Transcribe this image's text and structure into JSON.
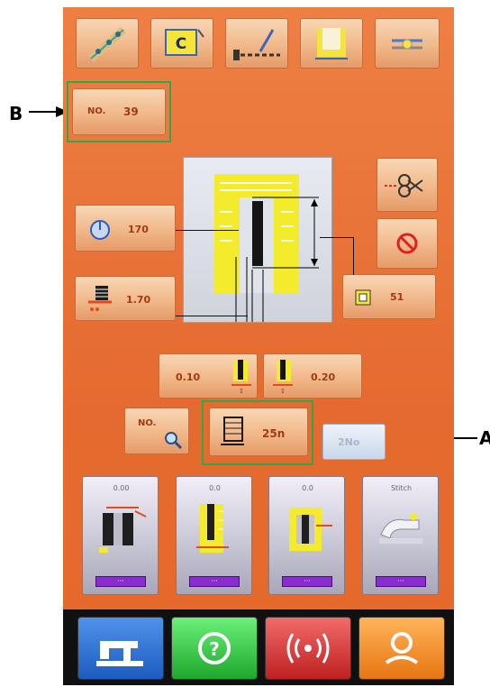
{
  "callouts": {
    "b_label": "B",
    "a_label": "A"
  },
  "toolbar": {
    "items": [
      {
        "name": "thread-path-icon"
      },
      {
        "name": "c-pattern-icon",
        "glyph": "C"
      },
      {
        "name": "stitch-line-icon"
      },
      {
        "name": "bartack-frame-icon"
      },
      {
        "name": "tension-icon"
      }
    ]
  },
  "pattern_no": {
    "label": "NO.",
    "value": "39"
  },
  "params": {
    "speed": "170",
    "width": "1.70",
    "length_left": "0.10",
    "length_right": "0.20",
    "counter": "51",
    "stitches": "25n"
  },
  "sub_buttons": {
    "no_search_label": "NO.",
    "disabled_label": "2No"
  },
  "cards": [
    {
      "top": "0.00",
      "tag": "···"
    },
    {
      "top": "0.0",
      "tag": "···"
    },
    {
      "top": "0.0",
      "tag": "···"
    },
    {
      "top": "Stitch",
      "tag": "···"
    }
  ],
  "colors": {
    "panel": "#e9753a",
    "highlight": "#2ea84c",
    "nav_blue": "#2a73d6",
    "nav_green": "#30c040",
    "nav_red": "#d43030",
    "nav_orange": "#f07f20"
  }
}
